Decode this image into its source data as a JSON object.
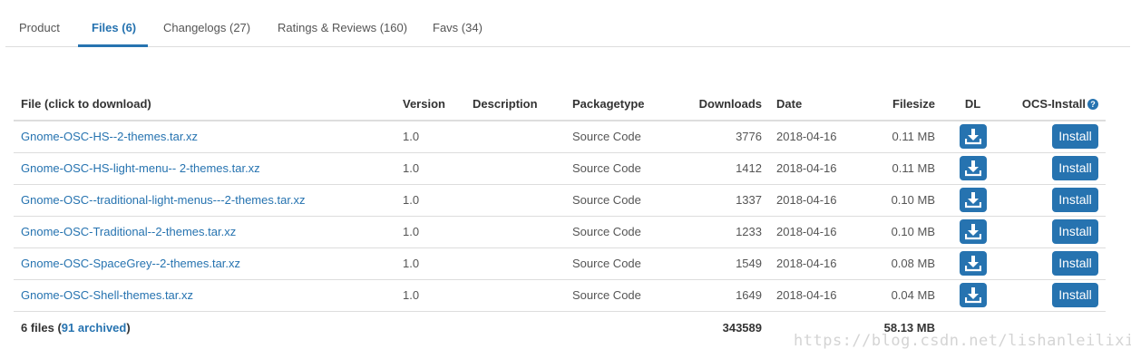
{
  "tabs": [
    {
      "label": "Product"
    },
    {
      "label": "Files (6)"
    },
    {
      "label": "Changelogs (27)"
    },
    {
      "label": "Ratings & Reviews (160)"
    },
    {
      "label": "Favs (34)"
    }
  ],
  "active_tab": "Files (6)",
  "table": {
    "headers": {
      "file": "File (click to download)",
      "version": "Version",
      "description": "Description",
      "packagetype": "Packagetype",
      "downloads": "Downloads",
      "date": "Date",
      "filesize": "Filesize",
      "dl": "DL",
      "ocs_install": "OCS-Install",
      "help_icon_glyph": "?"
    },
    "rows": [
      {
        "file": "Gnome-OSC-HS--2-themes.tar.xz",
        "version": "1.0",
        "description": "",
        "packagetype": "Source Code",
        "downloads": "3776",
        "date": "2018-04-16",
        "filesize": "0.11 MB",
        "install_label": "Install"
      },
      {
        "file": "Gnome-OSC-HS-light-menu-- 2-themes.tar.xz",
        "version": "1.0",
        "description": "",
        "packagetype": "Source Code",
        "downloads": "1412",
        "date": "2018-04-16",
        "filesize": "0.11 MB",
        "install_label": "Install"
      },
      {
        "file": "Gnome-OSC--traditional-light-menus---2-themes.tar.xz",
        "version": "1.0",
        "description": "",
        "packagetype": "Source Code",
        "downloads": "1337",
        "date": "2018-04-16",
        "filesize": "0.10 MB",
        "install_label": "Install"
      },
      {
        "file": "Gnome-OSC-Traditional--2-themes.tar.xz",
        "version": "1.0",
        "description": "",
        "packagetype": "Source Code",
        "downloads": "1233",
        "date": "2018-04-16",
        "filesize": "0.10 MB",
        "install_label": "Install"
      },
      {
        "file": "Gnome-OSC-SpaceGrey--2-themes.tar.xz",
        "version": "1.0",
        "description": "",
        "packagetype": "Source Code",
        "downloads": "1549",
        "date": "2018-04-16",
        "filesize": "0.08 MB",
        "install_label": "Install"
      },
      {
        "file": "Gnome-OSC-Shell-themes.tar.xz",
        "version": "1.0",
        "description": "",
        "packagetype": "Source Code",
        "downloads": "1649",
        "date": "2018-04-16",
        "filesize": "0.04 MB",
        "install_label": "Install"
      }
    ],
    "footer": {
      "files_prefix": "6 files (",
      "archived": "91 archived",
      "files_suffix": ")",
      "total_downloads": "343589",
      "total_filesize": "58.13 MB"
    }
  },
  "watermark": "https://blog.csdn.net/lishanleilixin",
  "icons": {
    "dl": "download-icon",
    "help": "help-icon"
  },
  "colors": {
    "accent": "#2673b0",
    "text": "#333333",
    "muted_text": "#555555",
    "border": "#dddddd",
    "watermark": "#d4d4d4"
  }
}
